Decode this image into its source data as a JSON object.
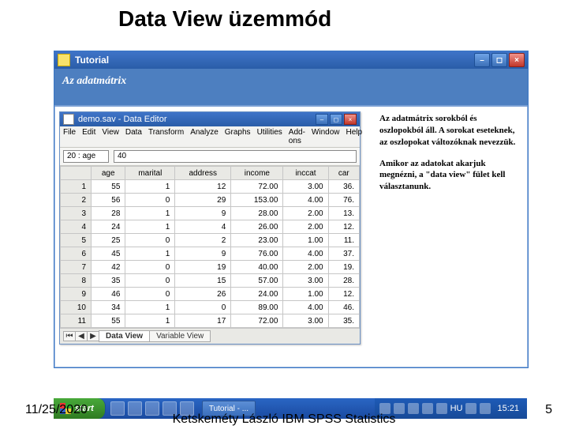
{
  "slide": {
    "title": "Data View üzemmód",
    "date": "11/25/2020",
    "footer": "Ketskeméty László IBM SPSS Statistics",
    "page": "5"
  },
  "tutorial": {
    "window_title": "Tutorial",
    "heading": "Az adatmátrix",
    "side_paragraph_1": "Az adatmátrix sorokból és oszlopokból áll. A sorokat eseteknek, az oszlopokat változóknak nevezzük.",
    "side_paragraph_2": "Amikor az adatokat akarjuk megnézni, a \"data view\" fület kell választanunk."
  },
  "editor": {
    "window_title": "demo.sav - Data Editor",
    "menus": [
      "File",
      "Edit",
      "View",
      "Data",
      "Transform",
      "Analyze",
      "Graphs",
      "Utilities",
      "Add-ons",
      "Window",
      "Help"
    ],
    "cell_ref": "20 : age",
    "cell_val": "40",
    "columns": [
      "age",
      "marital",
      "address",
      "income",
      "inccat",
      "car"
    ],
    "rows": [
      [
        "55",
        "1",
        "12",
        "72.00",
        "3.00",
        "36."
      ],
      [
        "56",
        "0",
        "29",
        "153.00",
        "4.00",
        "76."
      ],
      [
        "28",
        "1",
        "9",
        "28.00",
        "2.00",
        "13."
      ],
      [
        "24",
        "1",
        "4",
        "26.00",
        "2.00",
        "12."
      ],
      [
        "25",
        "0",
        "2",
        "23.00",
        "1.00",
        "11."
      ],
      [
        "45",
        "1",
        "9",
        "76.00",
        "4.00",
        "37."
      ],
      [
        "42",
        "0",
        "19",
        "40.00",
        "2.00",
        "19."
      ],
      [
        "35",
        "0",
        "15",
        "57.00",
        "3.00",
        "28."
      ],
      [
        "46",
        "0",
        "26",
        "24.00",
        "1.00",
        "12."
      ],
      [
        "34",
        "1",
        "0",
        "89.00",
        "4.00",
        "46."
      ],
      [
        "55",
        "1",
        "17",
        "72.00",
        "3.00",
        "35."
      ]
    ],
    "tabs": {
      "data_view": "Data View",
      "variable_view": "Variable View"
    }
  },
  "taskbar": {
    "start": "start",
    "task_item": "Tutorial - ...",
    "lang": "HU",
    "clock": "15:21"
  }
}
